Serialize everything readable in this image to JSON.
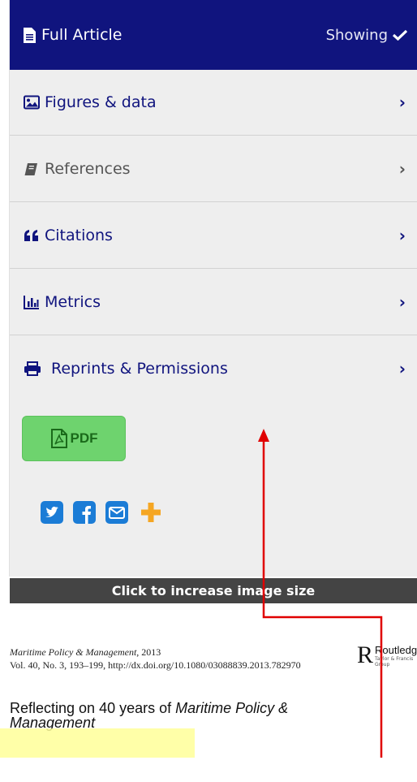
{
  "header": {
    "title": "Full Article",
    "status": "Showing"
  },
  "menu": [
    {
      "label": "Figures & data",
      "icon": "image-icon",
      "muted": false
    },
    {
      "label": "References",
      "icon": "book-icon",
      "muted": true
    },
    {
      "label": "Citations",
      "icon": "quote-icon",
      "muted": false
    },
    {
      "label": "Metrics",
      "icon": "bar-chart-icon",
      "muted": false
    },
    {
      "label": "Reprints & Permissions",
      "icon": "print-icon",
      "muted": false
    }
  ],
  "chevron": "›",
  "pdf_label": "PDF",
  "share_icons": [
    "twitter-icon",
    "facebook-icon",
    "email-icon",
    "plus-icon"
  ],
  "caption": "Click to increase image size",
  "article": {
    "journal_name": "Maritime Policy & Management",
    "journal_year": ", 2013",
    "journal_line2": "Vol. 40, No. 3, 193–199, http://dx.doi.org/10.1080/03088839.2013.782970",
    "publisher": "Routledge",
    "publisher_sub": "Taylor & Francis Group",
    "title_part1": "Reflecting on 40 years of ",
    "title_italic": "Maritime Policy &",
    "title_line2": "Management"
  },
  "colors": {
    "header_bg": "#10147e",
    "link": "#10147e",
    "pdf_green": "#6ed36e",
    "share_blue": "#1b7cd6",
    "share_orange": "#f5a623",
    "annotation_red": "#e00000",
    "highlight": "#ffff99"
  }
}
